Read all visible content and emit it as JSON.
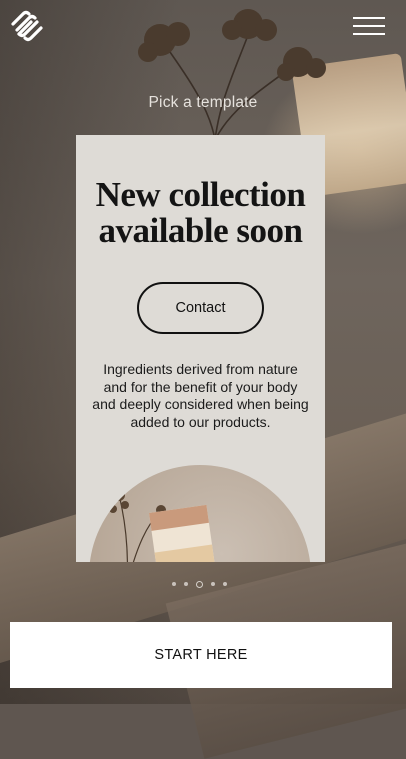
{
  "header": {
    "logo_icon": "squarespace-logo-icon",
    "menu_icon": "hamburger-menu-icon"
  },
  "hint": "Pick a template",
  "card": {
    "title_line1": "New collection",
    "title_line2": "available soon",
    "contact_label": "Contact",
    "description": "Ingredients derived from nature and for the benefit of your body and deeply considered when being added to our products."
  },
  "carousel": {
    "dot_count": 5,
    "active_index": 2
  },
  "cta": {
    "start_label": "START HERE"
  },
  "colors": {
    "card_bg": "#dedbd6",
    "cta_bg": "#ffffff",
    "text_dark": "#111111"
  }
}
